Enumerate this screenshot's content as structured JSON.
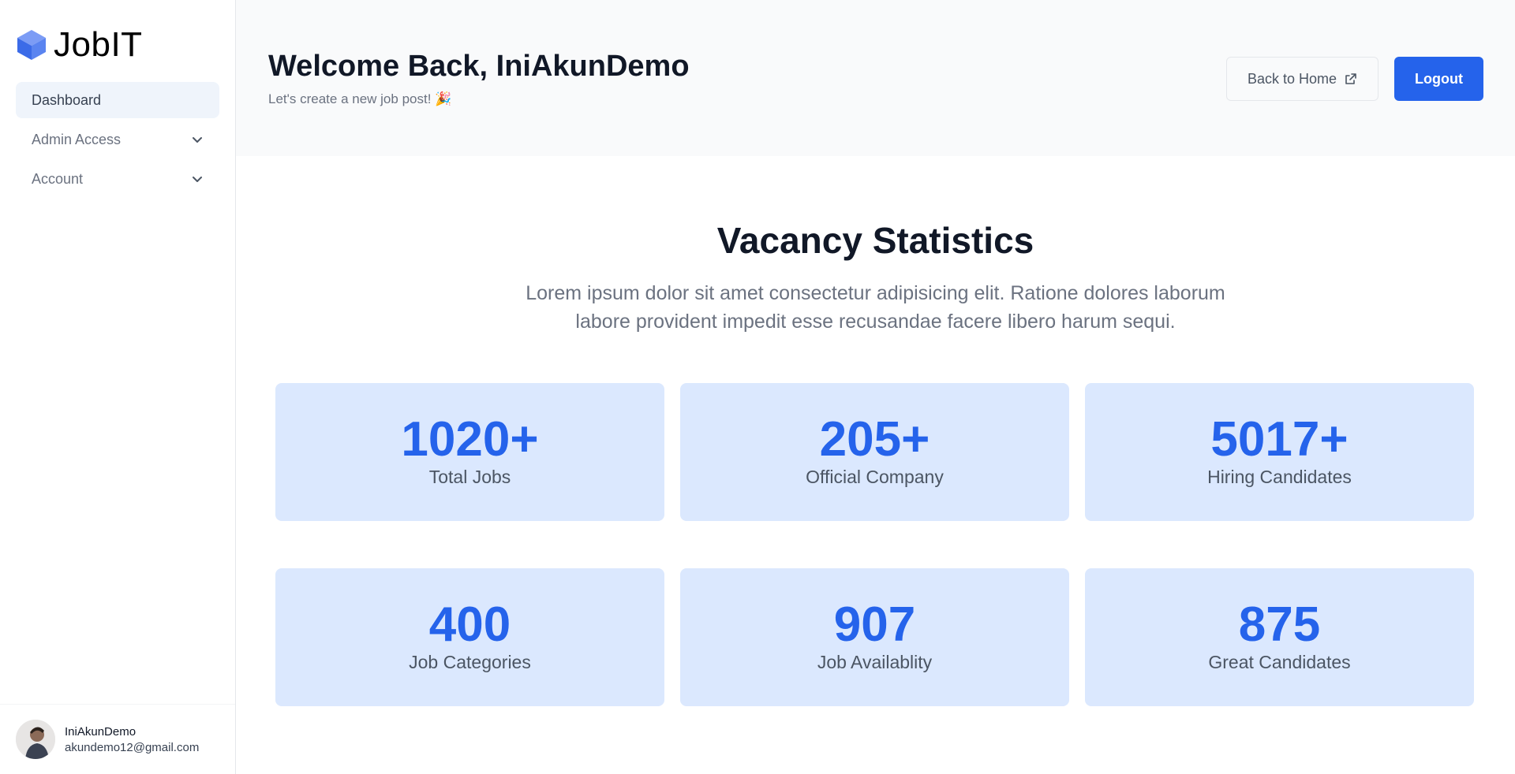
{
  "brand": {
    "name": "JobIT",
    "logo_icon": "cube-icon",
    "logo_color": "#4f7cf0"
  },
  "sidebar": {
    "items": [
      {
        "label": "Dashboard",
        "active": true
      },
      {
        "label": "Admin Access",
        "icon": "chevron-down-icon"
      },
      {
        "label": "Account",
        "icon": "chevron-down-icon"
      }
    ]
  },
  "user": {
    "name": "IniAkunDemo",
    "email": "akundemo12@gmail.com"
  },
  "header": {
    "title": "Welcome Back, IniAkunDemo",
    "subtitle": "Let's create a new job post! 🎉",
    "back_home_label": "Back to Home",
    "back_home_icon": "external-link-icon",
    "logout_label": "Logout"
  },
  "stats": {
    "title": "Vacancy Statistics",
    "description": "Lorem ipsum dolor sit amet consectetur adipisicing elit. Ratione dolores laborum labore provident impedit esse recusandae facere libero harum sequi.",
    "cards": [
      {
        "value": "1020+",
        "label": "Total Jobs"
      },
      {
        "value": "205+",
        "label": "Official Company"
      },
      {
        "value": "5017+",
        "label": "Hiring Candidates"
      },
      {
        "value": "400",
        "label": "Job Categories"
      },
      {
        "value": "907",
        "label": "Job Availablity"
      },
      {
        "value": "875",
        "label": "Great Candidates"
      }
    ]
  },
  "colors": {
    "accent": "#2563eb",
    "card_bg": "#dbe8fe",
    "header_bg": "#f9fafb"
  }
}
